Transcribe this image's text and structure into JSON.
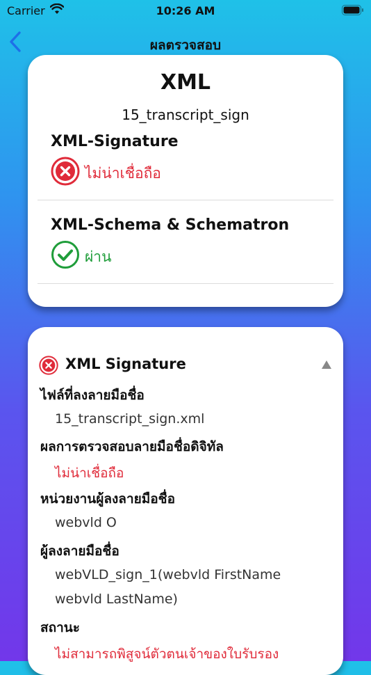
{
  "status_bar": {
    "carrier": "Carrier",
    "time": "10:26 AM"
  },
  "nav": {
    "title": "ผลตรวจสอบ"
  },
  "summary_card": {
    "heading": "XML",
    "file_name": "15_transcript_sign",
    "checks": [
      {
        "title": "XML-Signature",
        "result": "ไม่น่าเชื่อถือ",
        "status": "fail"
      },
      {
        "title": "XML-Schema & Schematron",
        "result": "ผ่าน",
        "status": "pass"
      }
    ]
  },
  "detail_card": {
    "title": "XML Signature",
    "status": "fail",
    "fields": [
      {
        "label": "ไฟล์ที่ลงลายมือชื่อ",
        "values": [
          "15_transcript_sign.xml"
        ]
      },
      {
        "label": "ผลการตรวจสอบลายมือชื่อดิจิทัล",
        "values": [
          "ไม่น่าเชื่อถือ"
        ]
      },
      {
        "label": "หน่วยงานผู้ลงลายมือชื่อ",
        "values": [
          "webvld O"
        ]
      },
      {
        "label": "ผู้ลงลายมือชื่อ",
        "values": [
          "webVLD_sign_1(webvld FirstName",
          "webvld LastName)"
        ]
      },
      {
        "label": "สถานะ",
        "values": [
          "ไม่สามารถพิสูจน์ตัวตนเจ้าของใบรับรอง"
        ]
      }
    ]
  },
  "colors": {
    "fail": "#e02b3a",
    "pass": "#1f9d3a",
    "accent": "#1e6fe8"
  },
  "icons": {
    "back": "chevron-left-icon",
    "fail": "x-circle-icon",
    "pass": "check-circle-icon",
    "collapse": "triangle-up-icon"
  }
}
